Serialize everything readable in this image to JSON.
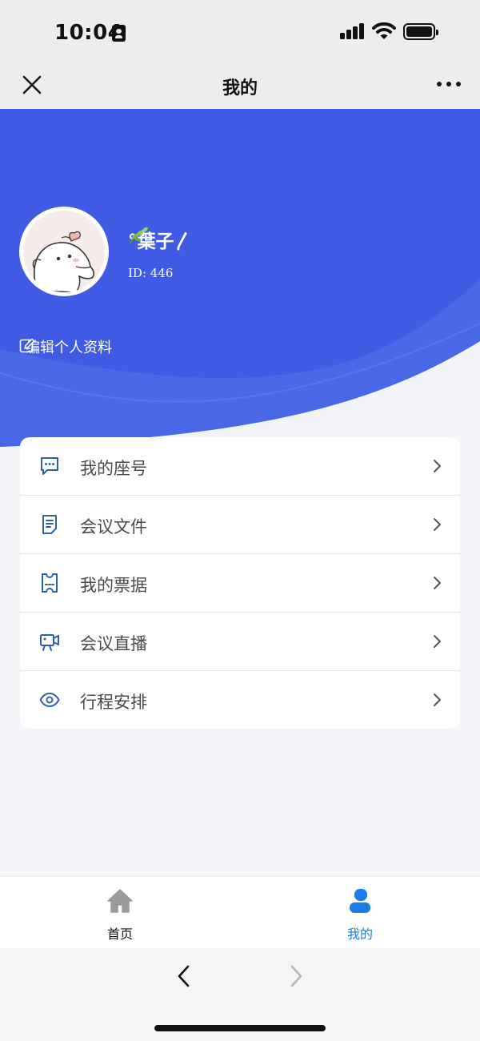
{
  "status_bar": {
    "time": "10:04"
  },
  "nav": {
    "title": "我的"
  },
  "profile": {
    "username": "°葉子〳",
    "user_id": "ID: 446",
    "edit_label": "编辑个人资料"
  },
  "menu": [
    {
      "label": "我的座号",
      "icon": "chat-bubble-icon"
    },
    {
      "label": "会议文件",
      "icon": "document-icon"
    },
    {
      "label": "我的票据",
      "icon": "ticket-icon"
    },
    {
      "label": "会议直播",
      "icon": "video-camera-icon"
    },
    {
      "label": "行程安排",
      "icon": "eye-icon"
    }
  ],
  "tabbar": {
    "home_label": "首页",
    "mine_label": "我的"
  },
  "colors": {
    "hero_blue": "#415ce4",
    "icon_blue": "#2f5fa8",
    "tab_active": "#1a7de6",
    "tab_inactive": "#9a9a9a"
  }
}
